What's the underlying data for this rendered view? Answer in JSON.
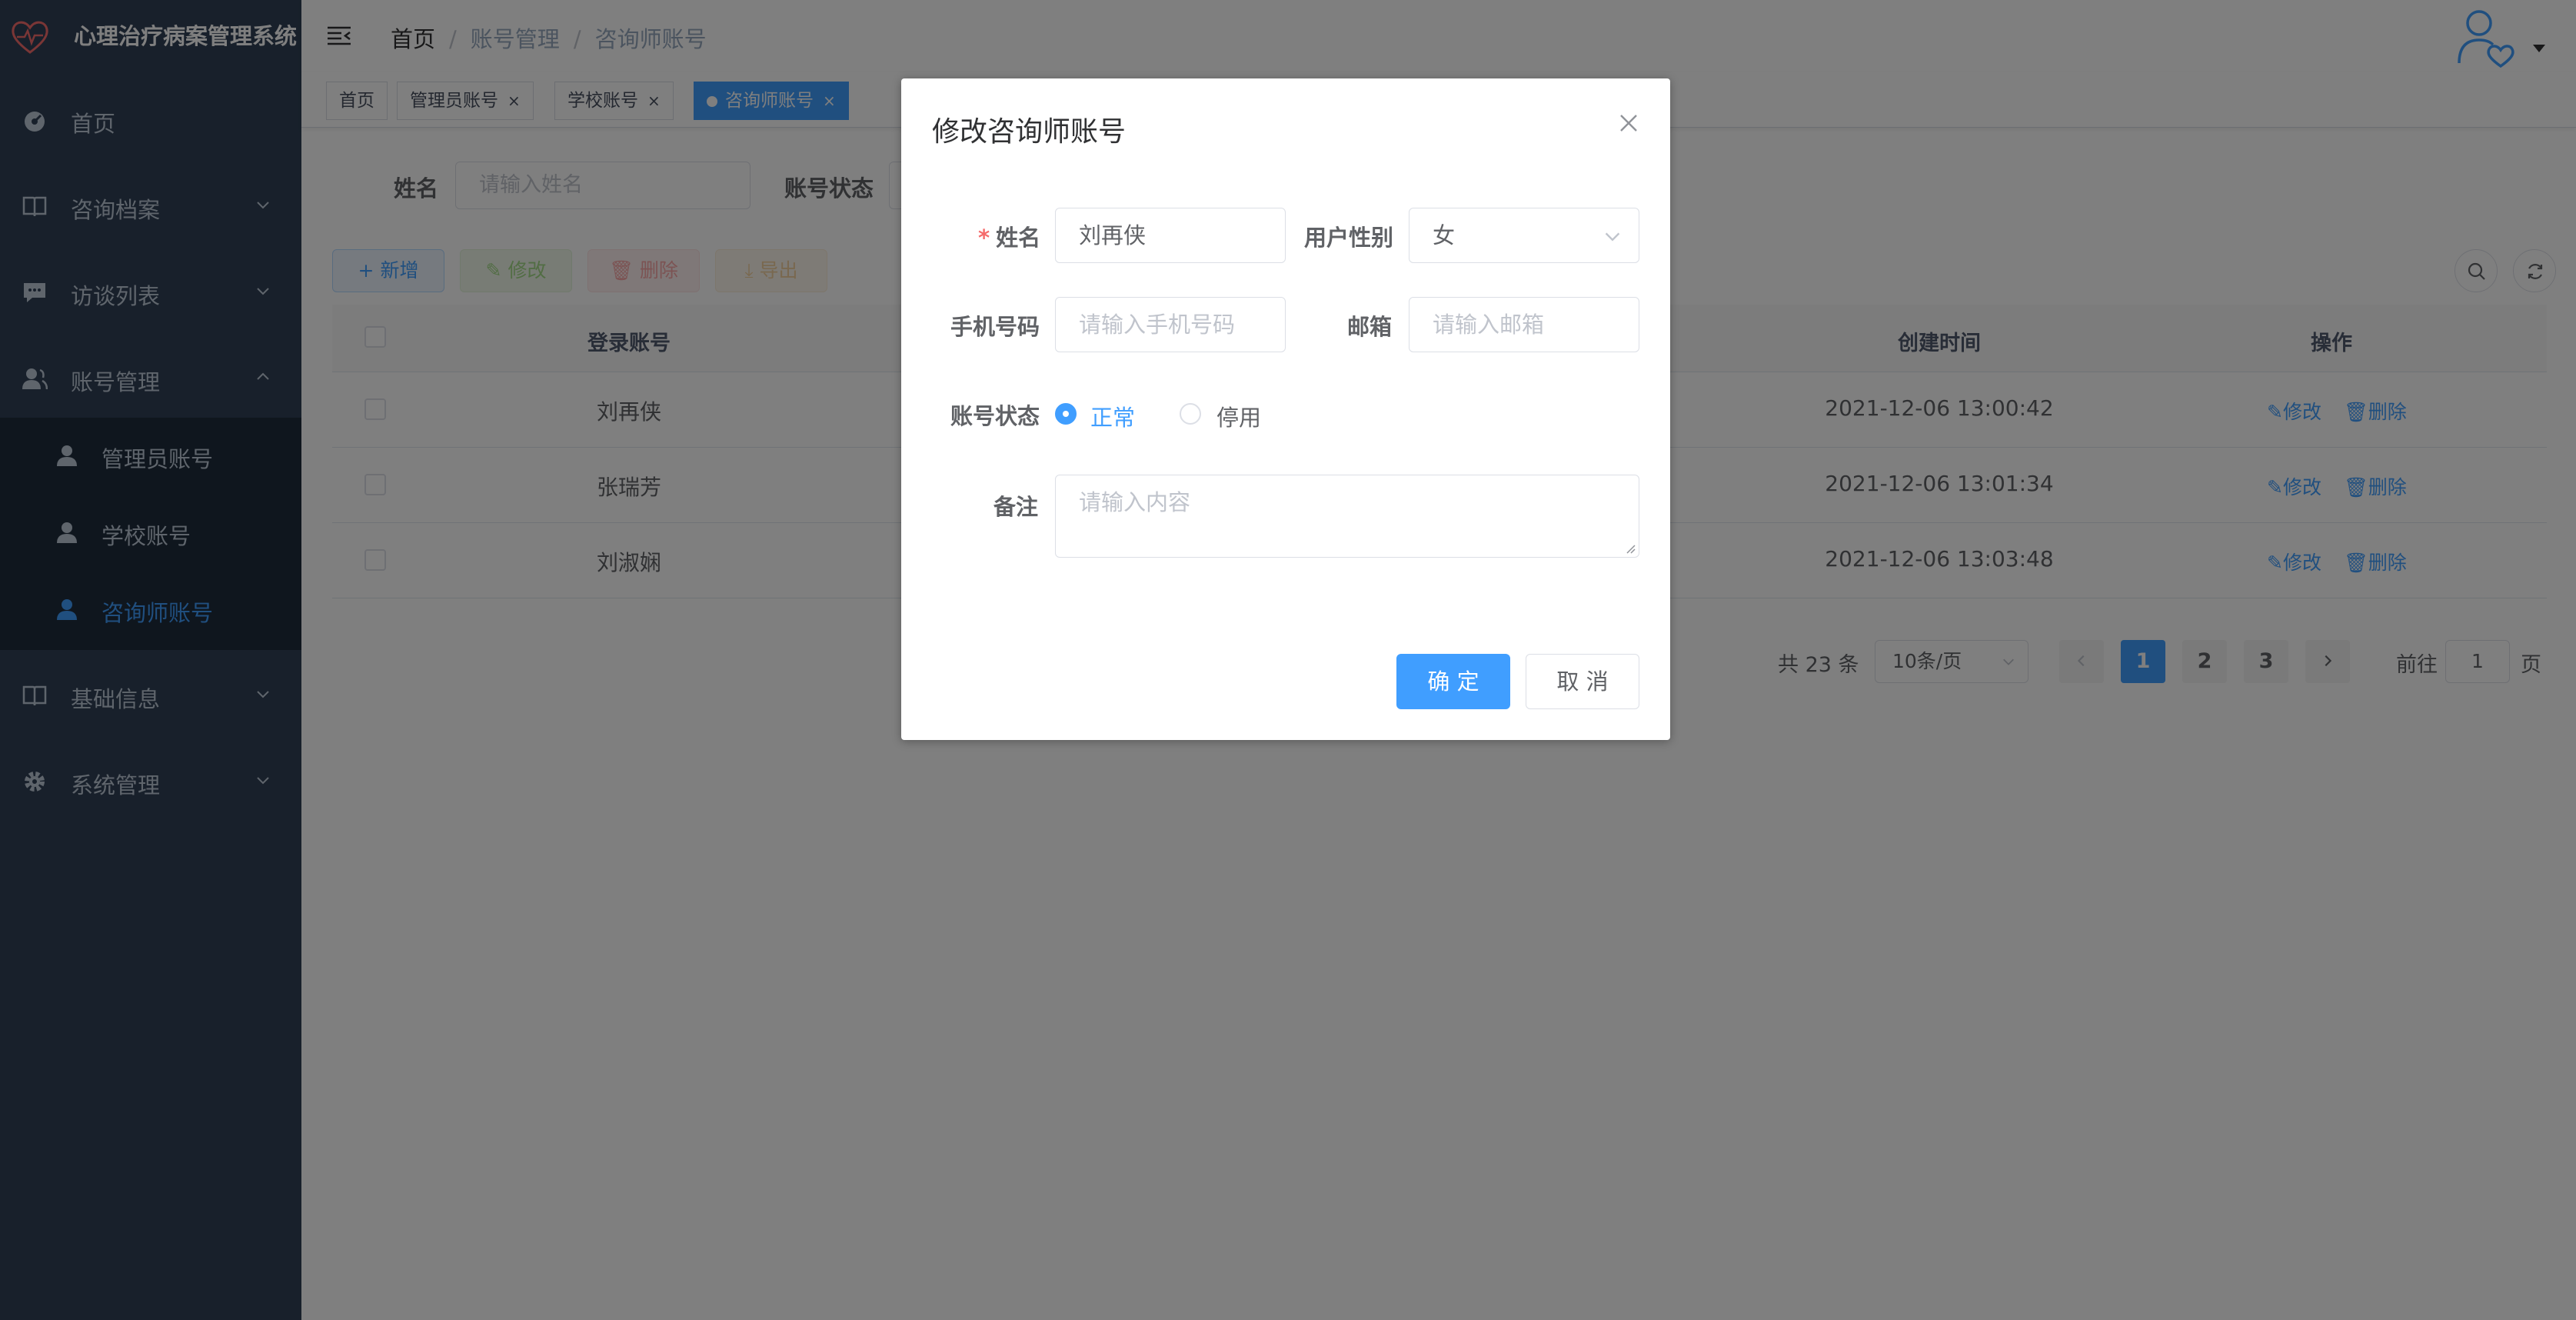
{
  "app": {
    "title": "心理治疗病案管理系统",
    "logo_icon": "heart-logo-icon"
  },
  "sidebar": {
    "items": [
      {
        "label": "首页",
        "icon": "dashboard-icon"
      },
      {
        "label": "咨询档案",
        "icon": "book-icon"
      },
      {
        "label": "访谈列表",
        "icon": "chat-icon"
      },
      {
        "label": "账号管理",
        "icon": "user-icon",
        "expanded": true
      },
      {
        "label": "基础信息",
        "icon": "book-icon"
      },
      {
        "label": "系统管理",
        "icon": "gear-icon"
      }
    ],
    "subitems": [
      {
        "label": "管理员账号"
      },
      {
        "label": "学校账号"
      },
      {
        "label": "咨询师账号",
        "active": true
      }
    ]
  },
  "breadcrumb": {
    "items": [
      "首页",
      "账号管理",
      "咨询师账号"
    ],
    "separator": "/"
  },
  "tags": [
    {
      "label": "首页"
    },
    {
      "label": "管理员账号",
      "close": "×"
    },
    {
      "label": "学校账号",
      "close": "×"
    },
    {
      "label": "咨询师账号",
      "close": "×",
      "active": true
    }
  ],
  "search": {
    "name_label": "姓名",
    "name_placeholder": "请输入姓名",
    "status_label": "账号状态"
  },
  "toolbar": {
    "add": "+ 新增",
    "edit": "修改",
    "delete": "删除",
    "export": "导出"
  },
  "table": {
    "columns": {
      "account": "登录账号",
      "created": "创建时间",
      "ops": "操作"
    },
    "rows": [
      {
        "account": "刘再侠",
        "created": "2021-12-06 13:00:42"
      },
      {
        "account": "张瑞芳",
        "created": "2021-12-06 13:01:34"
      },
      {
        "account": "刘淑娴",
        "created": "2021-12-06 13:03:48"
      }
    ],
    "op_edit": "修改",
    "op_delete": "删除"
  },
  "pagination": {
    "total": "共 23 条",
    "page_size": "10条/页",
    "pages": [
      "1",
      "2",
      "3"
    ],
    "current": "1",
    "goto_prefix": "前往",
    "goto_value": "1",
    "goto_suffix": "页"
  },
  "dialog": {
    "title": "修改咨询师账号",
    "name_label": "姓名",
    "name_required_mark": "*",
    "name_value": "刘再侠",
    "gender_label": "用户性别",
    "gender_value": "女",
    "phone_label": "手机号码",
    "phone_placeholder": "请输入手机号码",
    "email_label": "邮箱",
    "email_placeholder": "请输入邮箱",
    "status_label": "账号状态",
    "status_options": [
      "正常",
      "停用"
    ],
    "status_selected": "正常",
    "remark_label": "备注",
    "remark_placeholder": "请输入内容",
    "confirm": "确 定",
    "cancel": "取 消"
  },
  "colors": {
    "sidebar_bg": "#304156",
    "submenu_bg": "#1f2d3d",
    "accent": "#409eff",
    "required": "#f56c6c"
  }
}
